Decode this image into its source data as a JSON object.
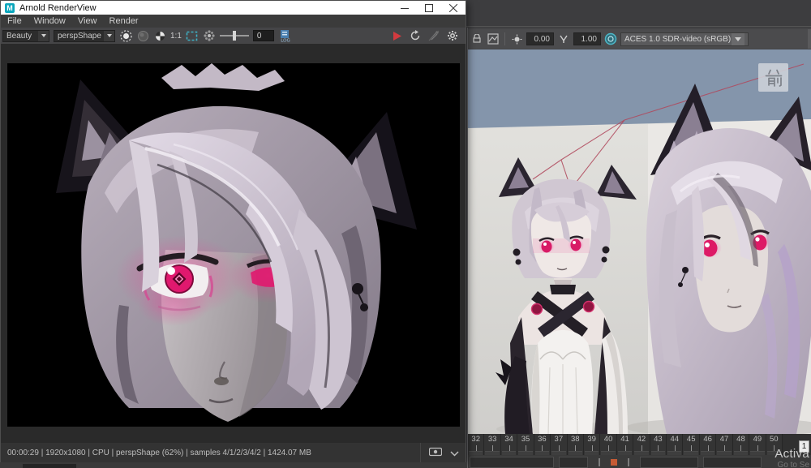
{
  "arnold_window": {
    "title": "Arnold RenderView",
    "menu": [
      "File",
      "Window",
      "View",
      "Render"
    ],
    "toolbar": {
      "aov": "Beauty",
      "camera": "perspShape",
      "zoom_ratio": "1:1",
      "debug_value": "0",
      "log_label": "LOG"
    },
    "status": "00:00:29 | 1920x1080 | CPU | perspShape (62%) | samples 4/1/2/3/4/2 | 1424.07 MB"
  },
  "maya_panel": {
    "toolbar": {
      "exposure": "0.00",
      "gamma": "1.00",
      "colorspace": "ACES 1.0 SDR-video (sRGB)"
    },
    "viewport": {
      "orientation_label": "前"
    },
    "timeline": {
      "frames": [
        "32",
        "33",
        "34",
        "35",
        "36",
        "37",
        "38",
        "39",
        "40",
        "41",
        "42",
        "43",
        "44",
        "45",
        "46",
        "47",
        "48",
        "49",
        "50"
      ],
      "range_end": "1"
    },
    "watermark": {
      "line1": "Activa",
      "line2": "Go to Se"
    }
  },
  "colors": {
    "viewport_background": "#8495ab",
    "accent_teal": "#3fb0c4",
    "play_red": "#d23a3f",
    "eye_magenta": "#e0186e",
    "glow_pink": "#ff5fb0",
    "hair_silver": "#cfc6d2"
  }
}
